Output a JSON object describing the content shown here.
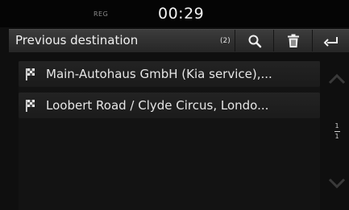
{
  "statusbar": {
    "reg_label": "REG",
    "clock": "00:29"
  },
  "header": {
    "title": "Previous destination",
    "count": "(2)",
    "search_icon": "search-icon",
    "delete_icon": "trash-icon",
    "back_icon": "back-arrow-icon"
  },
  "destinations": [
    {
      "icon": "checkered-flag-icon",
      "label": "Main-Autohaus GmbH (Kia service),..."
    },
    {
      "icon": "checkered-flag-icon",
      "label": "Loobert Road / Clyde Circus, Londo..."
    }
  ],
  "pager": {
    "current": "1",
    "total": "1"
  },
  "colors": {
    "background": "#0f0f0f",
    "titlebar": "#333333",
    "text": "#e6e6e6",
    "disabled_arrow": "#3a3a3a"
  }
}
